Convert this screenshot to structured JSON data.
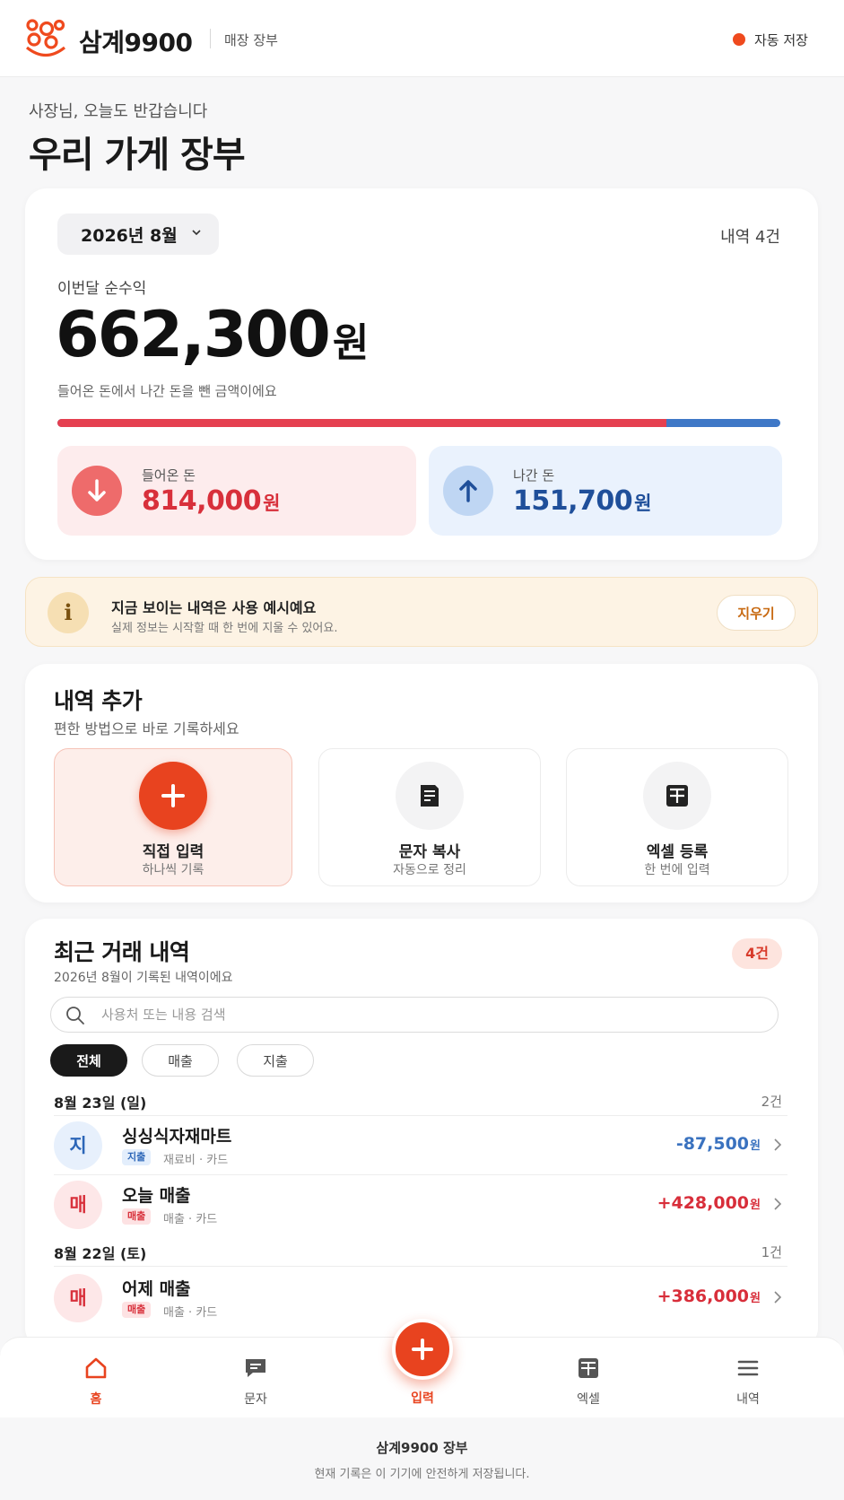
{
  "header": {
    "brand": "삼계9900",
    "sub": "매장 장부",
    "autosave": "자동 저장",
    "accent": "#ef4a1e"
  },
  "hero": {
    "greeting": "사장님, 오늘도 반갑습니다",
    "title": "우리 가게 장부"
  },
  "summary": {
    "month": "2026년 8월",
    "count": "내역 4건",
    "net_label": "이번달 순수익",
    "net_amount": "662,300",
    "unit": "원",
    "net_desc": "들어온 돈에서 나간 돈을 뺀 금액이에요",
    "income_share": 0.843,
    "income": {
      "label": "들어온 돈",
      "amount": "814,000",
      "icon": "arrow-down-icon",
      "color": "#d8303b"
    },
    "expense": {
      "label": "나간 돈",
      "amount": "151,700",
      "icon": "arrow-up-icon",
      "color": "#1f4f9a"
    }
  },
  "notice": {
    "icon": "info-icon",
    "title": "지금 보이는 내역은 사용 예시예요",
    "desc": "실제 정보는 시작할 때 한 번에 지울 수 있어요.",
    "clear_label": "지우기"
  },
  "add": {
    "title": "내역 추가",
    "sub": "편한 방법으로 바로 기록하세요",
    "options": [
      {
        "label": "직접 입력",
        "sub": "하나씩 기록",
        "icon": "plus-icon"
      },
      {
        "label": "문자 복사",
        "sub": "자동으로 정리",
        "icon": "document-icon"
      },
      {
        "label": "엑셀 등록",
        "sub": "한 번에 입력",
        "icon": "grid-icon"
      }
    ]
  },
  "recent": {
    "title": "최근 거래 내역",
    "sub": "2026년 8월이 기록된 내역이에요",
    "badge": "4건",
    "search_placeholder": "사용처 또는 내용 검색",
    "filters": [
      "전체",
      "매출",
      "지출"
    ],
    "groups": [
      {
        "date": "8월 23일 (일)",
        "count": "2건",
        "items": [
          {
            "avatar": "지",
            "name": "싱싱식자재마트",
            "tag": "지출",
            "meta": "재료비 · 카드",
            "amount": "-87,500",
            "unit": "원",
            "kind": "expense"
          },
          {
            "avatar": "매",
            "name": "오늘 매출",
            "tag": "매출",
            "meta": "매출 · 카드",
            "amount": "+428,000",
            "unit": "원",
            "kind": "income"
          }
        ]
      },
      {
        "date": "8월 22일 (토)",
        "count": "1건",
        "items": [
          {
            "avatar": "매",
            "name": "어제 매출",
            "tag": "매출",
            "meta": "매출 · 카드",
            "amount": "+386,000",
            "unit": "원",
            "kind": "income"
          }
        ]
      }
    ]
  },
  "nav": {
    "items": [
      {
        "label": "홈",
        "icon": "home-icon"
      },
      {
        "label": "문자",
        "icon": "message-icon"
      },
      {
        "label": "입력",
        "icon": "plus-icon"
      },
      {
        "label": "엑셀",
        "icon": "grid-icon"
      },
      {
        "label": "내역",
        "icon": "menu-icon"
      }
    ]
  },
  "footer": {
    "title": "삼계9900 장부",
    "sub": "현재 기록은 이 기기에 안전하게 저장됩니다."
  }
}
